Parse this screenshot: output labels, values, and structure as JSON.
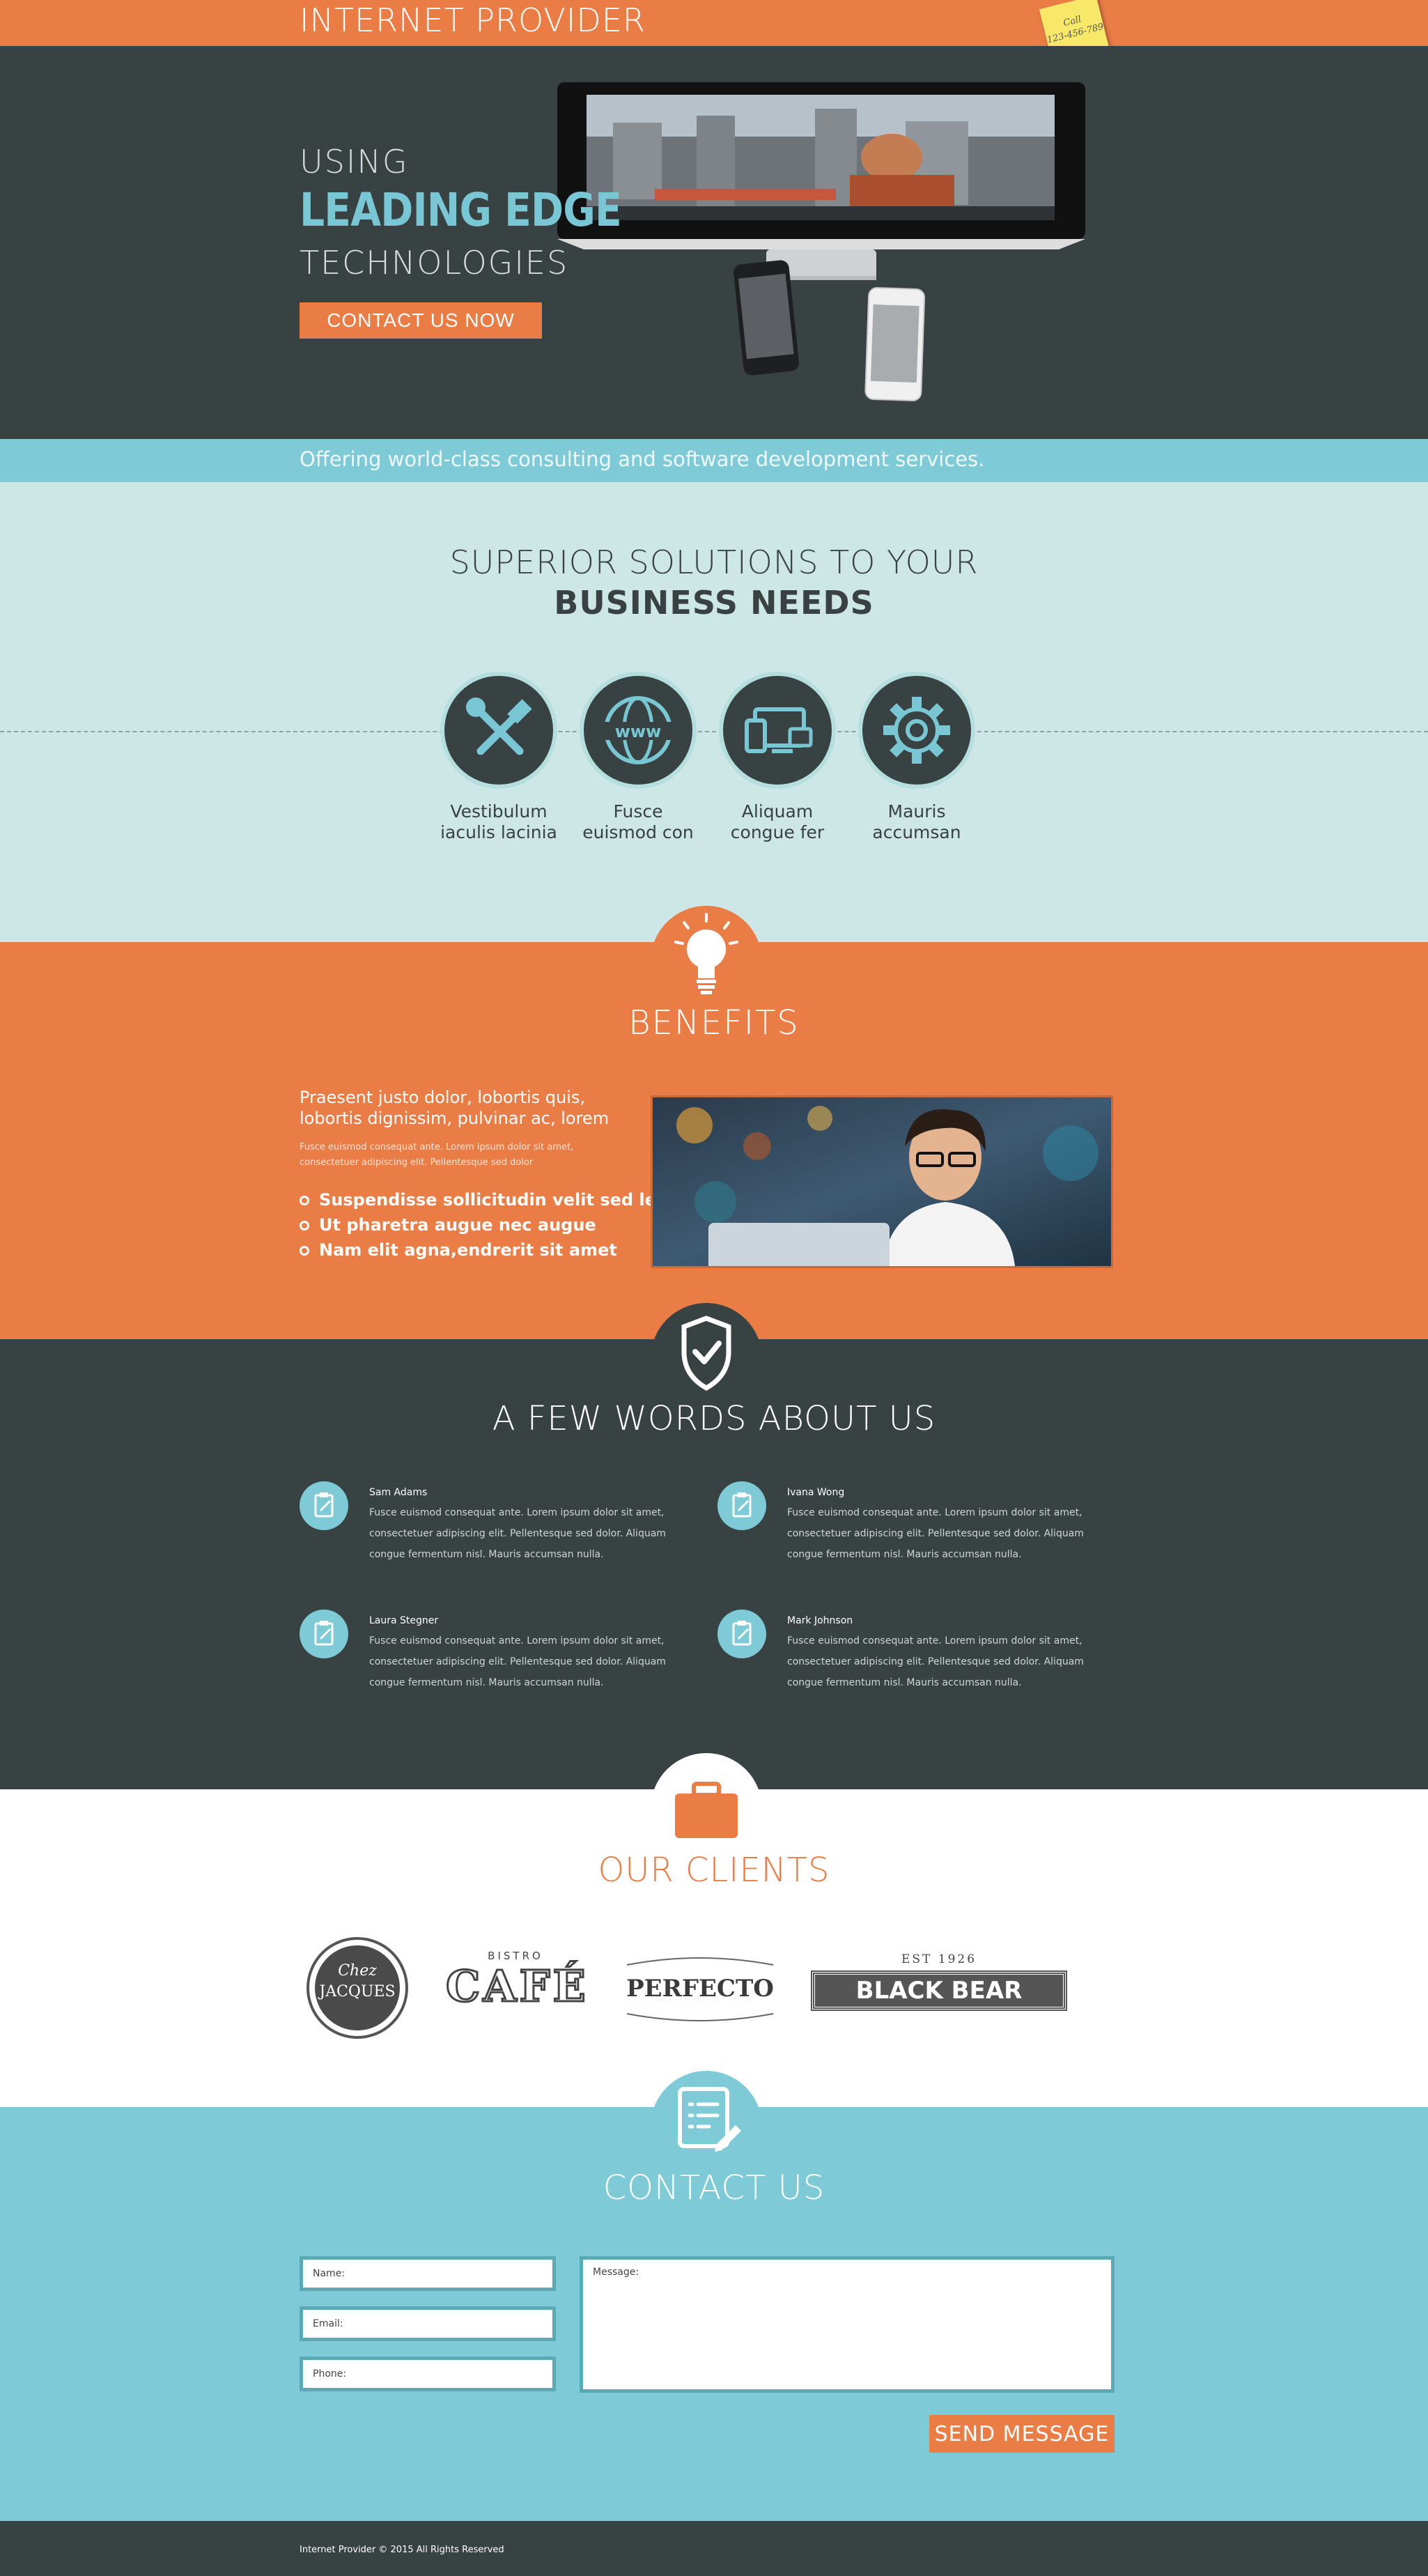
{
  "header": {
    "brand": "INTERNET PROVIDER",
    "note_line1": "Call",
    "note_line2": "123-456-789"
  },
  "hero": {
    "line1": "USING",
    "line2": "LEADING EDGE",
    "line3": "TECHNOLOGIES",
    "cta": "CONTACT US NOW"
  },
  "tagline": "Offering world-class consulting and software development services.",
  "solutions": {
    "title_line1": "SUPERIOR SOLUTIONS TO YOUR",
    "title_line2": "BUSINESS NEEDS",
    "items": [
      {
        "icon": "tools-icon",
        "line1": "Vestibulum",
        "line2": "iaculis lacinia"
      },
      {
        "icon": "www-globe-icon",
        "line1": "Fusce",
        "line2": "euismod con"
      },
      {
        "icon": "devices-icon",
        "line1": "Aliquam",
        "line2": "congue fer"
      },
      {
        "icon": "gear-icon",
        "line1": "Mauris",
        "line2": "accumsan"
      }
    ]
  },
  "benefits": {
    "title": "BENEFITS",
    "lead": "Praesent justo dolor, lobortis quis, lobortis dignissim, pulvinar ac, lorem",
    "small": "Fusce euismod consequat ante. Lorem ipsum dolor sit amet, consectetuer adipiscing elit. Pellentesque sed dolor",
    "bullets": [
      "Suspendisse sollicitudin velit sed leo",
      "Ut pharetra augue nec augue",
      "Nam elit agna,endrerit sit amet"
    ]
  },
  "about": {
    "title": "A FEW WORDS ABOUT US",
    "testimonials": [
      {
        "name": "Sam Adams",
        "text": "Fusce euismod consequat ante. Lorem ipsum dolor sit amet, consectetuer adipiscing elit. Pellentesque sed dolor. Aliquam congue fermentum nisl. Mauris accumsan nulla."
      },
      {
        "name": "Ivana Wong",
        "text": "Fusce euismod consequat ante. Lorem ipsum dolor sit amet, consectetuer adipiscing elit. Pellentesque sed dolor. Aliquam congue fermentum nisl. Mauris accumsan nulla."
      },
      {
        "name": "Laura Stegner",
        "text": "Fusce euismod consequat ante. Lorem ipsum dolor sit amet, consectetuer adipiscing elit. Pellentesque sed dolor. Aliquam congue fermentum nisl. Mauris accumsan nulla."
      },
      {
        "name": "Mark Johnson",
        "text": "Fusce euismod consequat ante. Lorem ipsum dolor sit amet, consectetuer adipiscing elit. Pellentesque sed dolor. Aliquam congue fermentum nisl. Mauris accumsan nulla."
      }
    ]
  },
  "clients": {
    "title": "OUR CLIENTS",
    "logos": {
      "chez_top": "Chez",
      "chez_bottom": "JACQUES",
      "cafe_top": "BISTRO",
      "cafe_main": "CAFÉ",
      "perfecto": "PERFECTO",
      "blackbear_top": "EST 1926",
      "blackbear_main": "BLACK BEAR"
    }
  },
  "contact": {
    "title": "CONTACT US",
    "name_placeholder": "Name:",
    "email_placeholder": "Email:",
    "phone_placeholder": "Phone:",
    "message_placeholder": "Message:",
    "send": "SEND MESSAGE"
  },
  "footer": {
    "text": "Internet Provider © 2015 All Rights Reserved"
  },
  "colors": {
    "orange": "#ea7c46",
    "dark": "#394243",
    "teal": "#7ecbd7",
    "light_teal": "#cde6e6"
  }
}
